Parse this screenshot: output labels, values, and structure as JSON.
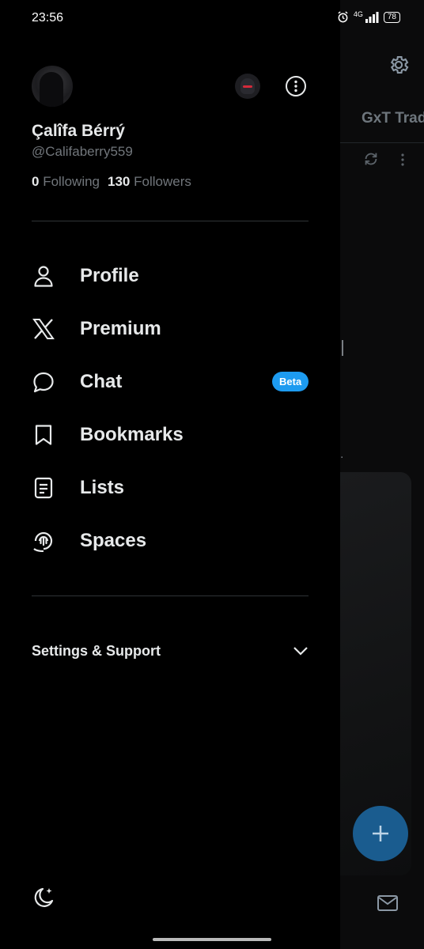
{
  "status_bar": {
    "time": "23:56",
    "network": "4G",
    "battery": "78"
  },
  "background": {
    "tab_label": "GxT Trad",
    "text_fragment": "s."
  },
  "drawer": {
    "profile": {
      "display_name": "Çalîfa Bérrý",
      "handle": "@Califaberry559",
      "following_count": "0",
      "following_label": "Following",
      "followers_count": "130",
      "followers_label": "Followers"
    },
    "menu": [
      {
        "label": "Profile",
        "icon": "person-icon"
      },
      {
        "label": "Premium",
        "icon": "x-logo-icon"
      },
      {
        "label": "Chat",
        "icon": "chat-bubble-icon",
        "badge": "Beta"
      },
      {
        "label": "Bookmarks",
        "icon": "bookmark-icon"
      },
      {
        "label": "Lists",
        "icon": "list-icon"
      },
      {
        "label": "Spaces",
        "icon": "spaces-icon"
      }
    ],
    "settings": {
      "label": "Settings & Support"
    }
  },
  "colors": {
    "background": "#000000",
    "text_primary": "#e7e9ea",
    "text_secondary": "#71767b",
    "accent": "#1d9bf0",
    "divider": "#2f3336"
  }
}
